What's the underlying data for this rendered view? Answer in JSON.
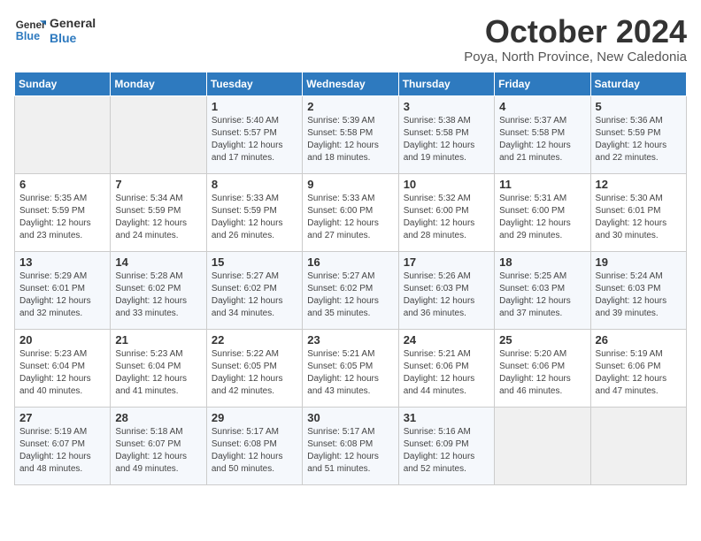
{
  "header": {
    "logo_line1": "General",
    "logo_line2": "Blue",
    "month": "October 2024",
    "location": "Poya, North Province, New Caledonia"
  },
  "days_of_week": [
    "Sunday",
    "Monday",
    "Tuesday",
    "Wednesday",
    "Thursday",
    "Friday",
    "Saturday"
  ],
  "weeks": [
    [
      {
        "day": "",
        "sunrise": "",
        "sunset": "",
        "daylight": ""
      },
      {
        "day": "",
        "sunrise": "",
        "sunset": "",
        "daylight": ""
      },
      {
        "day": "1",
        "sunrise": "Sunrise: 5:40 AM",
        "sunset": "Sunset: 5:57 PM",
        "daylight": "Daylight: 12 hours and 17 minutes."
      },
      {
        "day": "2",
        "sunrise": "Sunrise: 5:39 AM",
        "sunset": "Sunset: 5:58 PM",
        "daylight": "Daylight: 12 hours and 18 minutes."
      },
      {
        "day": "3",
        "sunrise": "Sunrise: 5:38 AM",
        "sunset": "Sunset: 5:58 PM",
        "daylight": "Daylight: 12 hours and 19 minutes."
      },
      {
        "day": "4",
        "sunrise": "Sunrise: 5:37 AM",
        "sunset": "Sunset: 5:58 PM",
        "daylight": "Daylight: 12 hours and 21 minutes."
      },
      {
        "day": "5",
        "sunrise": "Sunrise: 5:36 AM",
        "sunset": "Sunset: 5:59 PM",
        "daylight": "Daylight: 12 hours and 22 minutes."
      }
    ],
    [
      {
        "day": "6",
        "sunrise": "Sunrise: 5:35 AM",
        "sunset": "Sunset: 5:59 PM",
        "daylight": "Daylight: 12 hours and 23 minutes."
      },
      {
        "day": "7",
        "sunrise": "Sunrise: 5:34 AM",
        "sunset": "Sunset: 5:59 PM",
        "daylight": "Daylight: 12 hours and 24 minutes."
      },
      {
        "day": "8",
        "sunrise": "Sunrise: 5:33 AM",
        "sunset": "Sunset: 5:59 PM",
        "daylight": "Daylight: 12 hours and 26 minutes."
      },
      {
        "day": "9",
        "sunrise": "Sunrise: 5:33 AM",
        "sunset": "Sunset: 6:00 PM",
        "daylight": "Daylight: 12 hours and 27 minutes."
      },
      {
        "day": "10",
        "sunrise": "Sunrise: 5:32 AM",
        "sunset": "Sunset: 6:00 PM",
        "daylight": "Daylight: 12 hours and 28 minutes."
      },
      {
        "day": "11",
        "sunrise": "Sunrise: 5:31 AM",
        "sunset": "Sunset: 6:00 PM",
        "daylight": "Daylight: 12 hours and 29 minutes."
      },
      {
        "day": "12",
        "sunrise": "Sunrise: 5:30 AM",
        "sunset": "Sunset: 6:01 PM",
        "daylight": "Daylight: 12 hours and 30 minutes."
      }
    ],
    [
      {
        "day": "13",
        "sunrise": "Sunrise: 5:29 AM",
        "sunset": "Sunset: 6:01 PM",
        "daylight": "Daylight: 12 hours and 32 minutes."
      },
      {
        "day": "14",
        "sunrise": "Sunrise: 5:28 AM",
        "sunset": "Sunset: 6:02 PM",
        "daylight": "Daylight: 12 hours and 33 minutes."
      },
      {
        "day": "15",
        "sunrise": "Sunrise: 5:27 AM",
        "sunset": "Sunset: 6:02 PM",
        "daylight": "Daylight: 12 hours and 34 minutes."
      },
      {
        "day": "16",
        "sunrise": "Sunrise: 5:27 AM",
        "sunset": "Sunset: 6:02 PM",
        "daylight": "Daylight: 12 hours and 35 minutes."
      },
      {
        "day": "17",
        "sunrise": "Sunrise: 5:26 AM",
        "sunset": "Sunset: 6:03 PM",
        "daylight": "Daylight: 12 hours and 36 minutes."
      },
      {
        "day": "18",
        "sunrise": "Sunrise: 5:25 AM",
        "sunset": "Sunset: 6:03 PM",
        "daylight": "Daylight: 12 hours and 37 minutes."
      },
      {
        "day": "19",
        "sunrise": "Sunrise: 5:24 AM",
        "sunset": "Sunset: 6:03 PM",
        "daylight": "Daylight: 12 hours and 39 minutes."
      }
    ],
    [
      {
        "day": "20",
        "sunrise": "Sunrise: 5:23 AM",
        "sunset": "Sunset: 6:04 PM",
        "daylight": "Daylight: 12 hours and 40 minutes."
      },
      {
        "day": "21",
        "sunrise": "Sunrise: 5:23 AM",
        "sunset": "Sunset: 6:04 PM",
        "daylight": "Daylight: 12 hours and 41 minutes."
      },
      {
        "day": "22",
        "sunrise": "Sunrise: 5:22 AM",
        "sunset": "Sunset: 6:05 PM",
        "daylight": "Daylight: 12 hours and 42 minutes."
      },
      {
        "day": "23",
        "sunrise": "Sunrise: 5:21 AM",
        "sunset": "Sunset: 6:05 PM",
        "daylight": "Daylight: 12 hours and 43 minutes."
      },
      {
        "day": "24",
        "sunrise": "Sunrise: 5:21 AM",
        "sunset": "Sunset: 6:06 PM",
        "daylight": "Daylight: 12 hours and 44 minutes."
      },
      {
        "day": "25",
        "sunrise": "Sunrise: 5:20 AM",
        "sunset": "Sunset: 6:06 PM",
        "daylight": "Daylight: 12 hours and 46 minutes."
      },
      {
        "day": "26",
        "sunrise": "Sunrise: 5:19 AM",
        "sunset": "Sunset: 6:06 PM",
        "daylight": "Daylight: 12 hours and 47 minutes."
      }
    ],
    [
      {
        "day": "27",
        "sunrise": "Sunrise: 5:19 AM",
        "sunset": "Sunset: 6:07 PM",
        "daylight": "Daylight: 12 hours and 48 minutes."
      },
      {
        "day": "28",
        "sunrise": "Sunrise: 5:18 AM",
        "sunset": "Sunset: 6:07 PM",
        "daylight": "Daylight: 12 hours and 49 minutes."
      },
      {
        "day": "29",
        "sunrise": "Sunrise: 5:17 AM",
        "sunset": "Sunset: 6:08 PM",
        "daylight": "Daylight: 12 hours and 50 minutes."
      },
      {
        "day": "30",
        "sunrise": "Sunrise: 5:17 AM",
        "sunset": "Sunset: 6:08 PM",
        "daylight": "Daylight: 12 hours and 51 minutes."
      },
      {
        "day": "31",
        "sunrise": "Sunrise: 5:16 AM",
        "sunset": "Sunset: 6:09 PM",
        "daylight": "Daylight: 12 hours and 52 minutes."
      },
      {
        "day": "",
        "sunrise": "",
        "sunset": "",
        "daylight": ""
      },
      {
        "day": "",
        "sunrise": "",
        "sunset": "",
        "daylight": ""
      }
    ]
  ]
}
